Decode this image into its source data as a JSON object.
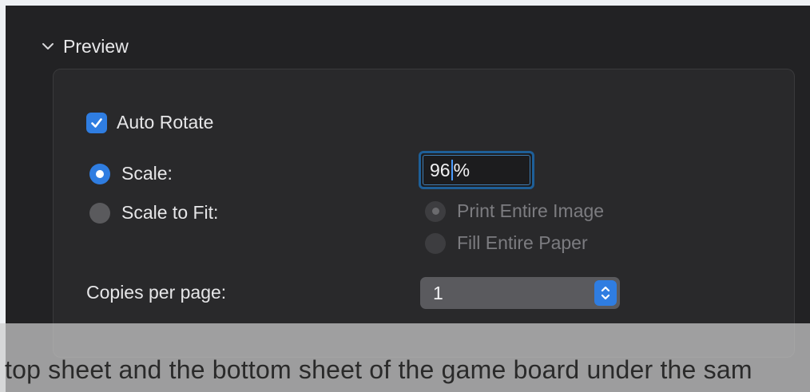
{
  "section": {
    "title": "Preview"
  },
  "auto_rotate": {
    "label": "Auto Rotate",
    "checked": true
  },
  "scale": {
    "label": "Scale:",
    "selected": true,
    "value_before_caret": "96",
    "value_after_caret": "%"
  },
  "scale_to_fit": {
    "label": "Scale to Fit:",
    "selected": false,
    "options": [
      {
        "label": "Print Entire Image",
        "selected": true,
        "enabled": false
      },
      {
        "label": "Fill Entire Paper",
        "selected": false,
        "enabled": false
      }
    ]
  },
  "copies_per_page": {
    "label": "Copies per page:",
    "value": "1"
  },
  "caption": {
    "text": "top sheet and the bottom sheet of the game board under the sam"
  },
  "colors": {
    "accent": "#2f7de1",
    "background": "#222224",
    "focus_ring": "#1e5f98"
  }
}
